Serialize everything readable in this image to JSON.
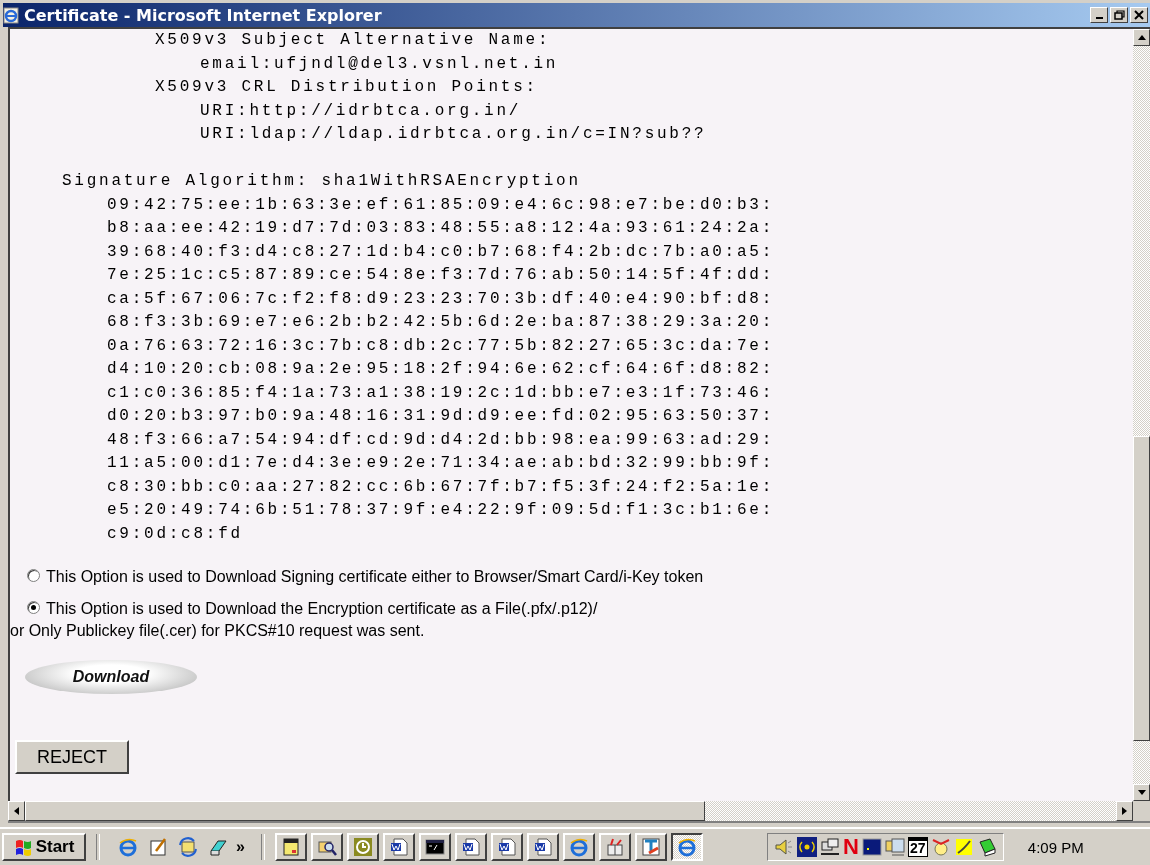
{
  "window": {
    "title": "Certificate - Microsoft Internet Explorer",
    "controls": [
      {
        "kind": "minimize"
      },
      {
        "kind": "restore"
      },
      {
        "kind": "close"
      }
    ]
  },
  "extensions": [
    {
      "text": "X509v3 Subject Alternative Name:",
      "children": [
        {
          "text": "email:ufjndl@del3.vsnl.net.in"
        }
      ]
    },
    {
      "text": "X509v3 CRL Distribution Points:",
      "children": [
        {
          "text": "URI:http://idrbtca.org.in/"
        },
        {
          "text": "URI:ldap://ldap.idrbtca.org.in/c=IN?sub??"
        }
      ]
    }
  ],
  "signature": {
    "text": "Signature Algorithm: sha1WithRSAEncryption",
    "children": [
      {
        "text": "09:42:75:ee:1b:63:3e:ef:61:85:09:e4:6c:98:e7:be:d0:b3:"
      },
      {
        "text": "b8:aa:ee:42:19:d7:7d:03:83:48:55:a8:12:4a:93:61:24:2a:"
      },
      {
        "text": "39:68:40:f3:d4:c8:27:1d:b4:c0:b7:68:f4:2b:dc:7b:a0:a5:"
      },
      {
        "text": "7e:25:1c:c5:87:89:ce:54:8e:f3:7d:76:ab:50:14:5f:4f:dd:"
      },
      {
        "text": "ca:5f:67:06:7c:f2:f8:d9:23:23:70:3b:df:40:e4:90:bf:d8:"
      },
      {
        "text": "68:f3:3b:69:e7:e6:2b:b2:42:5b:6d:2e:ba:87:38:29:3a:20:"
      },
      {
        "text": "0a:76:63:72:16:3c:7b:c8:db:2c:77:5b:82:27:65:3c:da:7e:"
      },
      {
        "text": "d4:10:20:cb:08:9a:2e:95:18:2f:94:6e:62:cf:64:6f:d8:82:"
      },
      {
        "text": "c1:c0:36:85:f4:1a:73:a1:38:19:2c:1d:bb:e7:e3:1f:73:46:"
      },
      {
        "text": "d0:20:b3:97:b0:9a:48:16:31:9d:d9:ee:fd:02:95:63:50:37:"
      },
      {
        "text": "48:f3:66:a7:54:94:df:cd:9d:d4:2d:bb:98:ea:99:63:ad:29:"
      },
      {
        "text": "11:a5:00:d1:7e:d4:3e:e9:2e:71:34:ae:ab:bd:32:99:bb:9f:"
      },
      {
        "text": "c8:30:bb:c0:aa:27:82:cc:6b:67:7f:b7:f5:3f:24:f2:5a:1e:"
      },
      {
        "text": "e5:20:49:74:6b:51:78:37:9f:e4:22:9f:09:5d:f1:3c:b1:6e:"
      },
      {
        "text": "c9:0d:c8:fd"
      }
    ]
  },
  "options": [
    {
      "lines": [
        "This Option is used to Download Signing certificate either to Browser/Smart Card/i-Key token"
      ],
      "selected": false
    },
    {
      "lines": [
        "This Option is used to Download the Encryption certificate as a File(.pfx/.p12)/",
        "or Only Publickey file(.cer) for PKCS#10 request was sent."
      ],
      "selected": true
    }
  ],
  "download_button": "Download",
  "reject_button": "REJECT",
  "taskbar": {
    "start": "Start",
    "quick_launch": [
      {
        "kind": "ie"
      },
      {
        "kind": "notepad"
      },
      {
        "kind": "sync"
      },
      {
        "kind": "eraser"
      }
    ],
    "more": "»",
    "buttons": [
      {
        "kind": "notes",
        "selected": false
      },
      {
        "kind": "search",
        "selected": false
      },
      {
        "kind": "clock",
        "selected": false
      },
      {
        "kind": "word",
        "selected": false
      },
      {
        "kind": "cmd",
        "selected": false
      },
      {
        "kind": "word",
        "selected": false
      },
      {
        "kind": "word",
        "selected": false
      },
      {
        "kind": "word",
        "selected": false
      },
      {
        "kind": "ie",
        "selected": false
      },
      {
        "kind": "gift",
        "selected": false
      },
      {
        "kind": "font",
        "selected": false
      },
      {
        "kind": "ie",
        "selected": true
      }
    ],
    "tray": [
      {
        "kind": "speaker"
      },
      {
        "kind": "signal"
      },
      {
        "kind": "network"
      },
      {
        "kind": "letter",
        "label": "N"
      },
      {
        "kind": "square"
      },
      {
        "kind": "folders"
      },
      {
        "kind": "calendar",
        "label": "27"
      },
      {
        "kind": "face"
      },
      {
        "kind": "note"
      },
      {
        "kind": "book"
      }
    ],
    "clock": "4:09 PM"
  }
}
